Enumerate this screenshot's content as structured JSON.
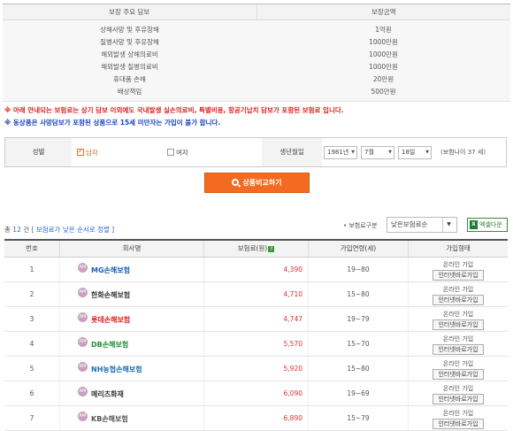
{
  "coverage": {
    "headers": [
      "보장 주요 담보",
      "보장금액"
    ],
    "rows": [
      [
        "상해사망 및 후유장해",
        "1억원"
      ],
      [
        "질병사망 및 후유장해",
        "1000만원"
      ],
      [
        "해외발생 상해의료비",
        "1000만원"
      ],
      [
        "해외발생 질병의료비",
        "1000만원"
      ],
      [
        "휴대품 손해",
        "20만원"
      ],
      [
        "배상책임",
        "500만원"
      ]
    ]
  },
  "notices": {
    "red": "※ 아래 안내되는 보험료는 상기 담보 이외에도 국내발생 실손의료비, 특별비용, 항공기납치 담보가 포함된 보험료 입니다.",
    "blue": "※ 동상품은 사망담보가 포함된 상품으로 15세 미만자는 가입이 불가 합니다."
  },
  "filter": {
    "gender_label": "성별",
    "male": "남자",
    "female": "여자",
    "birth_label": "생년월일",
    "year": "1981년",
    "month": "7월",
    "day": "18일",
    "age_text": "(보험나이 37    세)"
  },
  "compare_button": "상품비교하기",
  "results": {
    "count_prefix": "총",
    "count": "12",
    "count_suffix": "건",
    "sort_note": "[ 보험료가 낮은 순서로 정렬 ]",
    "sort_label": "• 보험료구분",
    "sort_value": "낮은보험료순",
    "excel_label": "엑셀다운",
    "headers": [
      "번호",
      "회사명",
      "보험료(원)",
      "가입연령(세)",
      "가입형태"
    ],
    "rows": [
      {
        "no": "1",
        "company": "MG손해보험",
        "premium": "4,390",
        "age": "19~80",
        "type": "온라인 가입",
        "btn": "인터넷바로가입",
        "color": "#1d5fb0"
      },
      {
        "no": "2",
        "company": "한화손해보험",
        "premium": "4,710",
        "age": "15~80",
        "type": "온라인 가입",
        "btn": "인터넷바로가입",
        "color": "#333333"
      },
      {
        "no": "3",
        "company": "롯데손해보험",
        "premium": "4,747",
        "age": "19~79",
        "type": "온라인 가입",
        "btn": "인터넷바로가입",
        "color": "#e02020"
      },
      {
        "no": "4",
        "company": "DB손해보험",
        "premium": "5,570",
        "age": "15~70",
        "type": "온라인 가입",
        "btn": "인터넷바로가입",
        "color": "#1f8f3a"
      },
      {
        "no": "5",
        "company": "NH농협손해보험",
        "premium": "5,920",
        "age": "15~80",
        "type": "온라인 가입",
        "btn": "인터넷바로가입",
        "color": "#1d6fb0"
      },
      {
        "no": "6",
        "company": "메리츠화재",
        "premium": "6,090",
        "age": "19~69",
        "type": "온라인 가입",
        "btn": "인터넷바로가입",
        "color": "#333333"
      },
      {
        "no": "7",
        "company": "KB손해보험",
        "premium": "6,890",
        "age": "15~79",
        "type": "온라인 가입",
        "btn": "인터넷바로가입",
        "color": "#555555"
      }
    ]
  }
}
